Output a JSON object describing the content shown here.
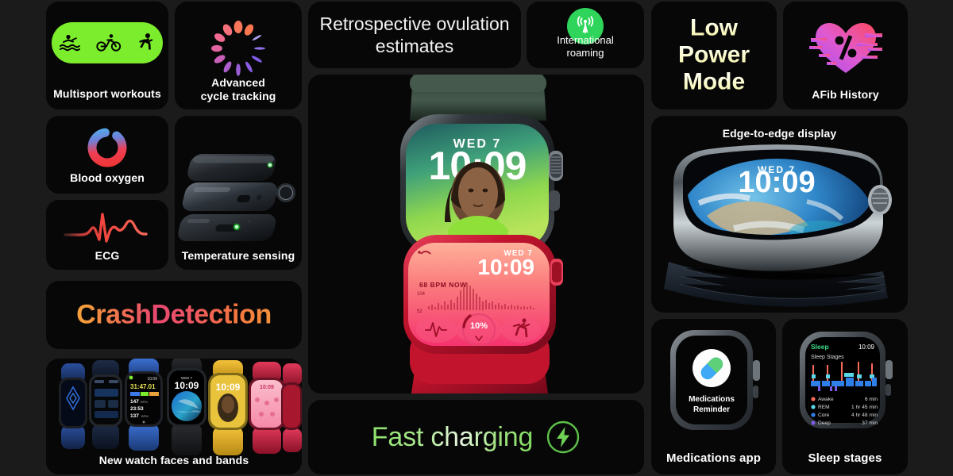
{
  "meta": {
    "background": "#1b1b1b",
    "card_background": "#070707"
  },
  "cards": {
    "multisport": {
      "label": "Multisport workouts",
      "pill_color": "#7ced2c",
      "icons": [
        "swim-icon",
        "bike-icon",
        "run-icon"
      ]
    },
    "cycle_tracking": {
      "label_line1": "Advanced",
      "label_line2": "cycle tracking",
      "icon": "cycle-ring-icon",
      "ring_colors": [
        "#f8765a",
        "#f46f62",
        "#ef6a7e",
        "#e2649b",
        "#c75fb4",
        "#a95ecb",
        "#8f5ddc",
        "#7b5ce6"
      ]
    },
    "ovulation": {
      "line1": "Retrospective ovulation",
      "line2": "estimates"
    },
    "roaming": {
      "icon": "cellular-antenna-icon",
      "icon_bg": "#2fd55b",
      "line1": "International",
      "line2": "roaming"
    },
    "low_power": {
      "line1": "Low",
      "line2": "Power",
      "line3": "Mode",
      "gradient_from": "#ffffff",
      "gradient_to": "#f2f09a"
    },
    "afib": {
      "label": "AFib History",
      "icon": "glitch-heart-percent-icon",
      "color_from": "#b957e8",
      "color_to": "#fa4a64"
    },
    "blood_oxygen": {
      "label": "Blood oxygen",
      "icon": "oxygen-ring-icon",
      "color_red": "#ef3b3b",
      "color_blue": "#4aa8ee"
    },
    "ecg": {
      "label": "ECG",
      "icon": "ecg-waveform-icon",
      "color": "#f2453d"
    },
    "temperature": {
      "label": "Temperature sensing",
      "image": "exploded-watch-sensors-photo",
      "led_color": "#2ecc40"
    },
    "crash_detection": {
      "text": "CrashDetection"
    },
    "watch_faces": {
      "label": "New watch faces and bands",
      "image": "watch-lineup-photo",
      "faces": [
        {
          "name": "blue-face",
          "color": "#1d4ed8"
        },
        {
          "name": "modular-face",
          "color": "#1b2c4a"
        },
        {
          "name": "workout-face",
          "time": "10:09",
          "metrics": [
            "31:47.01",
            "147 BPM",
            "23:53:27",
            "137 BPM"
          ]
        },
        {
          "name": "earth-face",
          "time": "10:09",
          "date": "WED 7"
        },
        {
          "name": "portrait-yellow-face",
          "time": "10:09"
        },
        {
          "name": "pink-face",
          "time": "10:09"
        },
        {
          "name": "red-face"
        }
      ]
    },
    "hero": {
      "top_watch": {
        "date": "WED 7",
        "time": "10:09",
        "face": "portrait-face",
        "case_color": "#3b4a42",
        "band_color": "#2f4038"
      },
      "bottom_watch": {
        "date": "WED 7",
        "time": "10:09",
        "heart_rate_label": "68 BPM NOW",
        "scale_high": "104",
        "scale_low": "52",
        "battery": "10%",
        "case_color": "#c2142d",
        "complications": [
          "ecg-complication",
          "battery-complication",
          "workout-complication"
        ]
      }
    },
    "fast_charging": {
      "text": "Fast charging",
      "icon": "lightning-bolt-circle-icon",
      "color": "#8fe06c"
    },
    "edge_display": {
      "label": "Edge-to-edge display",
      "image": "watch-earth-face-photo",
      "date": "WED 7",
      "time": "10:09"
    },
    "medications": {
      "label": "Medications app",
      "icon": "pill-capsule-icon",
      "screen_line1": "Medications",
      "screen_line2": "Reminder",
      "capsule_color_a": "#3fa9f5",
      "capsule_color_b": "#5fd07a"
    },
    "sleep": {
      "label": "Sleep stages",
      "screen": {
        "app_title": "Sleep",
        "time": "10:09",
        "subtitle": "Sleep Stages",
        "legend": [
          {
            "name": "Awake",
            "value": "6 min",
            "color": "#f96a5a"
          },
          {
            "name": "REM",
            "value": "1 hr 45 min",
            "color": "#5ad7e8"
          },
          {
            "name": "Core",
            "value": "4 hr 48 min",
            "color": "#2f7fe8"
          },
          {
            "name": "Deep",
            "value": "37 min",
            "color": "#7b5ce6"
          }
        ]
      }
    }
  }
}
